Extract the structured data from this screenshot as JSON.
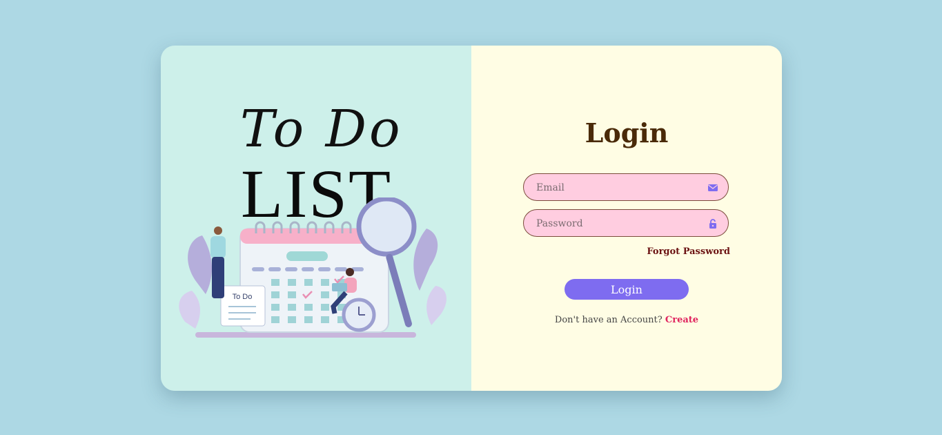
{
  "brand": {
    "script_title": "To Do",
    "caps_title": "LIST",
    "illustration_note": "To Do"
  },
  "login": {
    "heading": "Login",
    "email_placeholder": "Email",
    "password_placeholder": "Password",
    "forgot_label": "Forgot Password",
    "button_label": "Login",
    "signup_prompt": "Don't have an Account?",
    "signup_link": "Create"
  },
  "icons": {
    "email": "envelope-icon",
    "password": "lock-icon"
  },
  "colors": {
    "page_background": "#add8e4",
    "left_panel": "#cdf0ea",
    "right_panel": "#fffde4",
    "input_background": "#ffcde0",
    "accent": "#7e6cf0",
    "heading": "#4a2a08",
    "forgot_link": "#6b1212",
    "signup_link": "#e0245e"
  }
}
